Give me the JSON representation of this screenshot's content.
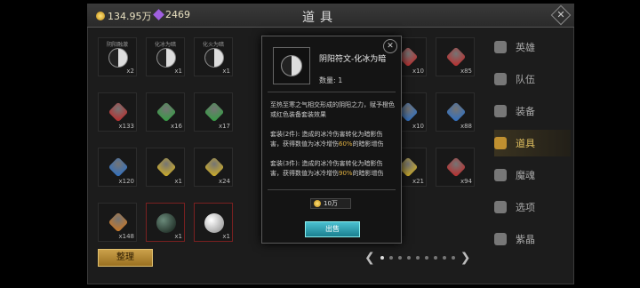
{
  "header": {
    "gold": "134.95万",
    "gems": "2469",
    "title": "道具"
  },
  "grid": {
    "slots": [
      {
        "label": "阴阳融澈",
        "count": "x2",
        "type": "yinyang"
      },
      {
        "label": "化冰为暗",
        "count": "x1",
        "type": "yinyang"
      },
      {
        "label": "化火为暗",
        "count": "x1",
        "type": "yinyang"
      },
      {
        "label": "",
        "count": "x10",
        "type": "red"
      },
      {
        "label": "",
        "count": "x85",
        "type": "red"
      },
      {
        "label": "",
        "count": "x133",
        "type": "red"
      },
      {
        "label": "",
        "count": "x16",
        "type": "green"
      },
      {
        "label": "",
        "count": "x17",
        "type": "green"
      },
      {
        "label": "",
        "count": "x10",
        "type": "blue"
      },
      {
        "label": "",
        "count": "x88",
        "type": "blue"
      },
      {
        "label": "",
        "count": "x120",
        "type": "blue"
      },
      {
        "label": "",
        "count": "x1",
        "type": "yellow"
      },
      {
        "label": "",
        "count": "x24",
        "type": "yellow"
      },
      {
        "label": "",
        "count": "x21",
        "type": "yellow"
      },
      {
        "label": "",
        "count": "x94",
        "type": "red"
      },
      {
        "label": "",
        "count": "x148",
        "type": "orange"
      },
      {
        "label": "",
        "count": "x1",
        "type": "darkorb"
      },
      {
        "label": "",
        "count": "x1",
        "type": "whiteorb"
      }
    ]
  },
  "sidebar": {
    "items": [
      {
        "label": "英雄",
        "icon": "heroes-icon"
      },
      {
        "label": "队伍",
        "icon": "flag-icon"
      },
      {
        "label": "装备",
        "icon": "helmet-icon"
      },
      {
        "label": "道具",
        "icon": "bag-icon"
      },
      {
        "label": "魔魂",
        "icon": "flame-icon"
      },
      {
        "label": "选项",
        "icon": "gear-icon"
      },
      {
        "label": "紫晶",
        "icon": "crystal-icon"
      }
    ]
  },
  "footer": {
    "sort_label": "整理"
  },
  "popup": {
    "name": "阴阳符文-化冰为暗",
    "qty": "数量: 1",
    "desc": "至热至寒之气相交形成的阴阳之力，赋予橙色或红色装备套装效果",
    "set2_pre": "套装(2件): 造成的冰冷伤害转化为暗影伤害，获得数值为冰冷增伤",
    "set2_val": "60%",
    "set2_post": "的暗影增伤",
    "set3_pre": "套装(3件): 造成的冰冷伤害转化为暗影伤害，获得数值为冰冷增伤",
    "set3_val": "90%",
    "set3_post": "的暗影增伤",
    "price": "10万",
    "sell_label": "出售"
  }
}
